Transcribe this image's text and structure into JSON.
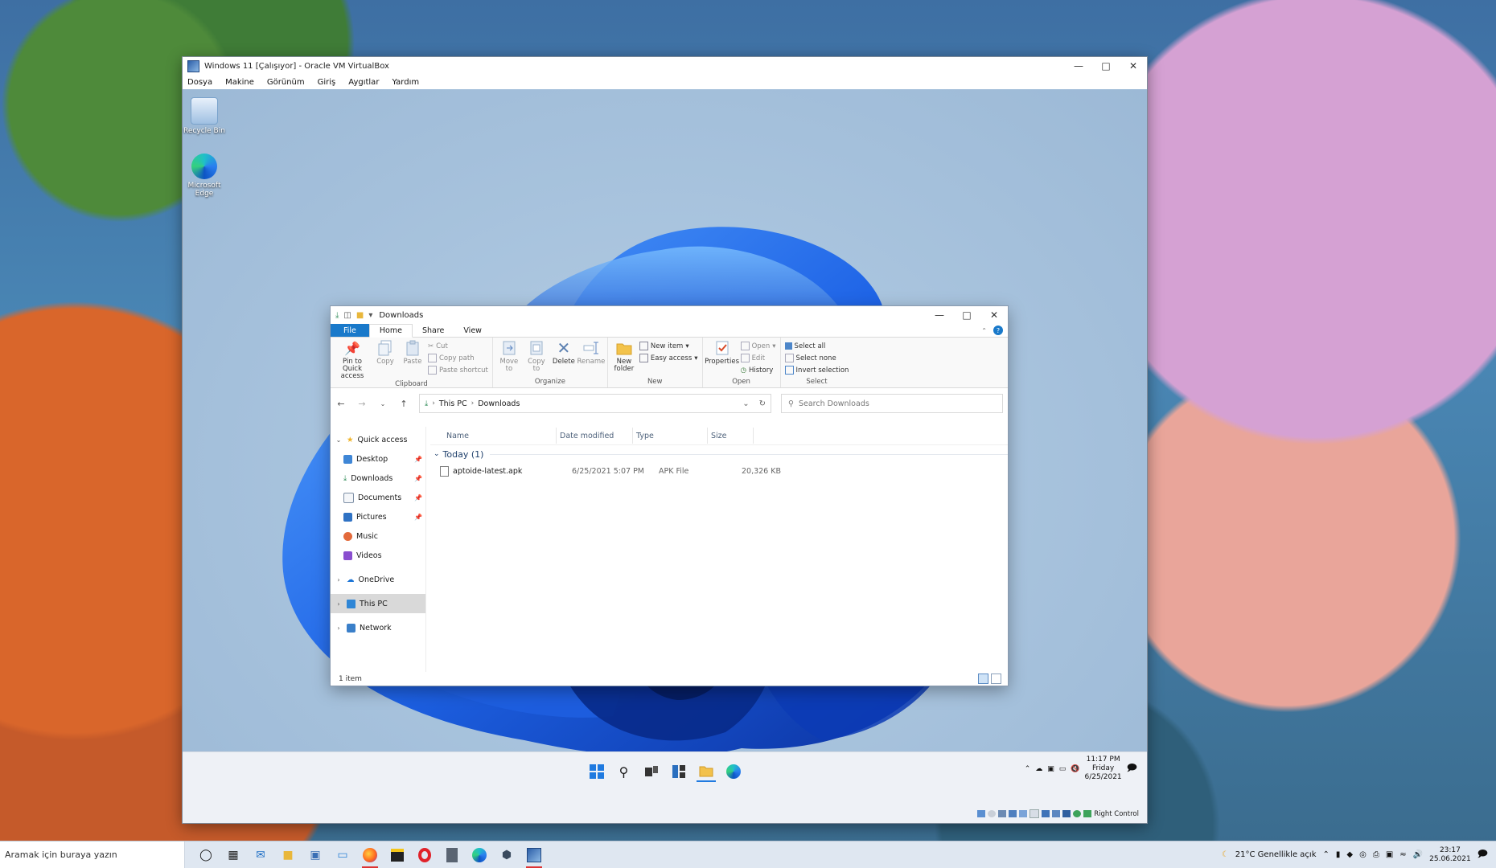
{
  "vbox": {
    "title": "Windows 11 [Çalışıyor] - Oracle VM VirtualBox",
    "menu": [
      "Dosya",
      "Makine",
      "Görünüm",
      "Giriş",
      "Aygıtlar",
      "Yardım"
    ],
    "status_label": "Right Control"
  },
  "desktop": {
    "icons": [
      {
        "label": "Recycle Bin",
        "icon": "recycle-bin-icon"
      },
      {
        "label": "Microsoft Edge",
        "icon": "edge-icon"
      }
    ]
  },
  "explorer": {
    "title": "Downloads",
    "tabs": {
      "file": "File",
      "home": "Home",
      "share": "Share",
      "view": "View"
    },
    "ribbon": {
      "clipboard": {
        "label": "Clipboard",
        "pin": "Pin to Quick access",
        "copy": "Copy",
        "paste": "Paste",
        "cut": "Cut",
        "copy_path": "Copy path",
        "paste_shortcut": "Paste shortcut"
      },
      "organize": {
        "label": "Organize",
        "move_to": "Move to",
        "copy_to": "Copy to",
        "delete": "Delete",
        "rename": "Rename"
      },
      "new": {
        "label": "New",
        "new_folder": "New folder",
        "new_item": "New item",
        "easy_access": "Easy access"
      },
      "open": {
        "label": "Open",
        "properties": "Properties",
        "open": "Open",
        "edit": "Edit",
        "history": "History"
      },
      "select": {
        "label": "Select",
        "select_all": "Select all",
        "select_none": "Select none",
        "invert": "Invert selection"
      }
    },
    "address": {
      "root": "This PC",
      "current": "Downloads"
    },
    "search": {
      "placeholder": "Search Downloads"
    },
    "nav": {
      "quick_access": "Quick access",
      "desktop": "Desktop",
      "downloads": "Downloads",
      "documents": "Documents",
      "pictures": "Pictures",
      "music": "Music",
      "videos": "Videos",
      "onedrive": "OneDrive",
      "this_pc": "This PC",
      "network": "Network"
    },
    "columns": {
      "name": "Name",
      "date": "Date modified",
      "type": "Type",
      "size": "Size"
    },
    "group": "Today (1)",
    "files": [
      {
        "name": "aptoide-latest.apk",
        "date": "6/25/2021 5:07 PM",
        "type": "APK File",
        "size": "20,326 KB"
      }
    ],
    "status": "1 item"
  },
  "guest_clock": {
    "time": "11:17 PM",
    "day": "Friday",
    "date": "6/25/2021"
  },
  "host": {
    "search_placeholder": "Aramak için buraya yazın",
    "weather": "21°C  Genellikle açık",
    "time": "23:17",
    "date": "25.06.2021"
  }
}
